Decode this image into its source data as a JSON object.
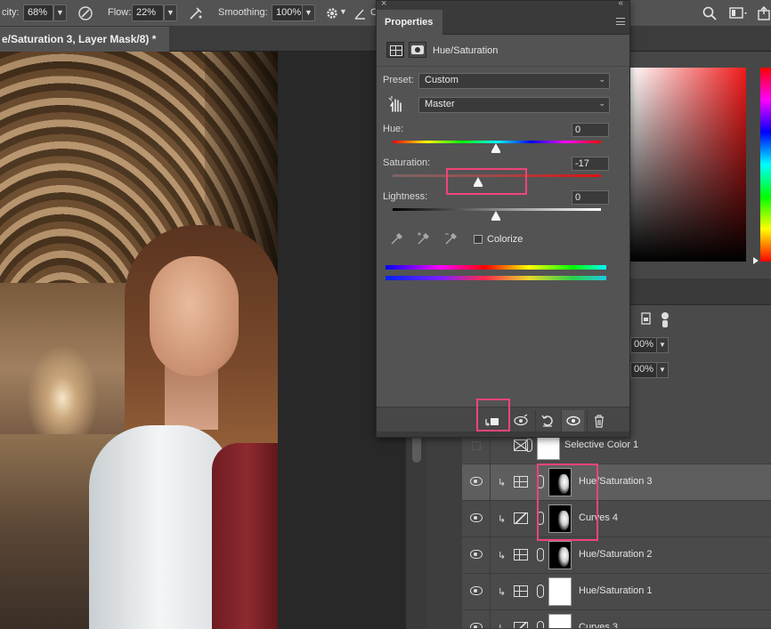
{
  "options_bar": {
    "opacity_label": "city:",
    "opacity_value": "68%",
    "flow_label": "Flow:",
    "flow_value": "22%",
    "smoothing_label": "Smoothing:",
    "smoothing_value": "100%",
    "angle_value_partial": "C"
  },
  "document": {
    "tab_title": "e/Saturation 3, Layer Mask/8) *"
  },
  "properties": {
    "tab_label": "Properties",
    "adjustment_title": "Hue/Saturation",
    "preset_label": "Preset:",
    "preset_value": "Custom",
    "channel_value": "Master",
    "hue_label": "Hue:",
    "hue_value": "0",
    "saturation_label": "Saturation:",
    "saturation_value": "-17",
    "lightness_label": "Lightness:",
    "lightness_value": "0",
    "colorize_label": "Colorize"
  },
  "layers_panel": {
    "opacity_value": "00%",
    "fill_value": "00%",
    "layers": [
      {
        "name": "Selective Color 1",
        "type": "selective-color",
        "mask": "white",
        "visible": false,
        "clipped": false
      },
      {
        "name": "Hue/Saturation 3",
        "type": "hue-saturation",
        "mask": "dark",
        "visible": true,
        "clipped": true,
        "selected": true
      },
      {
        "name": "Curves 4",
        "type": "curves",
        "mask": "dark",
        "visible": true,
        "clipped": true
      },
      {
        "name": "Hue/Saturation 2",
        "type": "hue-saturation",
        "mask": "dark",
        "visible": true,
        "clipped": true
      },
      {
        "name": "Hue/Saturation 1",
        "type": "hue-saturation",
        "mask": "white",
        "visible": true,
        "clipped": true
      },
      {
        "name": "Curves 3",
        "type": "curves",
        "mask": "white",
        "visible": true,
        "clipped": true
      }
    ]
  },
  "colors": {
    "highlight": "#f0447a",
    "panel_bg": "#535353",
    "dark_bg": "#282828"
  }
}
